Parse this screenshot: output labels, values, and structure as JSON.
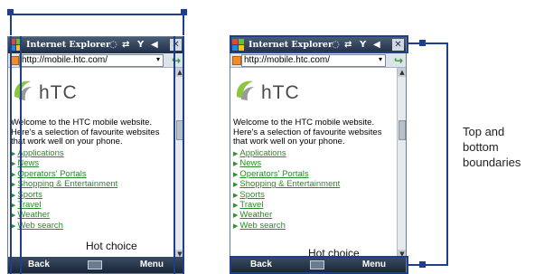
{
  "browser": {
    "title": "Internet Explorer",
    "status_icons": [
      "connectivity-icon",
      "sync-icon",
      "signal-icon",
      "volume-icon"
    ],
    "close_label": "✕",
    "address": "http://mobile.htc.com/",
    "dropdown_glyph": "▾",
    "go_glyph": "↪"
  },
  "page": {
    "logo_text": "hTC",
    "welcome_lines": [
      "Welcome to the HTC mobile website.",
      "Here's a selection of favourite websites",
      "that work well on your phone."
    ],
    "links": [
      "Applications",
      "News",
      "Operators' Portals",
      "Shopping & Entertainment",
      "Sports",
      "Travel",
      "Weather",
      "Web search"
    ],
    "hot_choice": "Hot choice"
  },
  "softkeys": {
    "left": "Back",
    "right": "Menu"
  },
  "annotation": {
    "text": "Top and\nbottom\nboundaries"
  },
  "colors": {
    "bracket": "#1e3f8c",
    "link": "#2a8a2a",
    "titlebar": "#1f2e44"
  }
}
